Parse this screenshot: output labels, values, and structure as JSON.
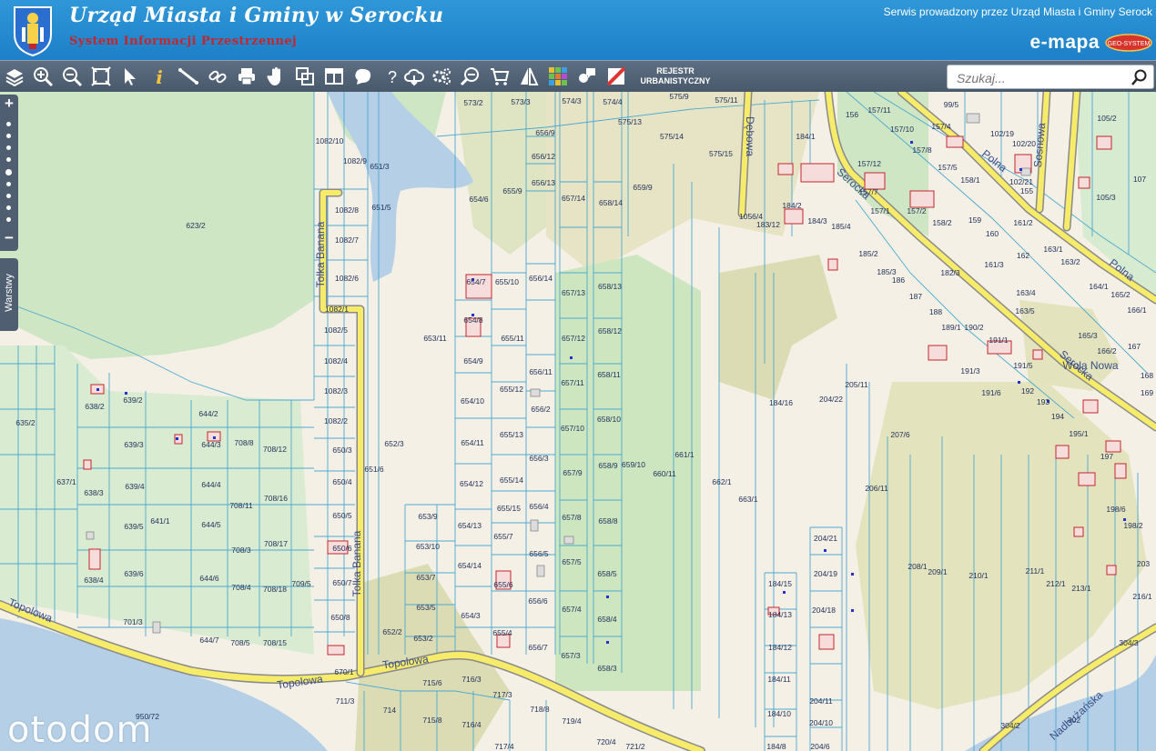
{
  "header": {
    "title": "Urząd Miasta i Gminy w Serocku",
    "subtitle": "System Informacji Przestrzennej",
    "service": "Serwis prowadzony przez Urząd Miasta i Gminy Serock",
    "brand": "e-mapa",
    "geo_logo": "GEO-SYSTEM"
  },
  "toolbar": {
    "tools": [
      "layers-icon",
      "zoom-in-icon",
      "zoom-out-icon",
      "zoom-extent-icon",
      "select-arrow-icon",
      "info-icon",
      "measure-distance-icon",
      "measure-link-icon",
      "print-icon",
      "pan-hand-icon",
      "copy-icon",
      "layout-icon",
      "shape-icon",
      "help-icon",
      "cloud-download-icon",
      "settings-icon",
      "search-zoom-icon",
      "cart-icon",
      "symbol-icon",
      "grid-color-icon",
      "comment-icon",
      "cancel-slash-icon"
    ],
    "rejestr_line1": "REJESTR",
    "rejestr_line2": "URBANISTYCZNY",
    "search_placeholder": "Szukaj..."
  },
  "side": {
    "zoom_in": "+",
    "zoom_out": "−",
    "layers_tab": "Warstwy"
  },
  "map": {
    "streets": [
      "Topolowa",
      "Topolowa",
      "Topolowa",
      "Tolka Banana",
      "Tolka Banana",
      "Dębowa",
      "Serocka",
      "Serocka",
      "Polna",
      "Polna",
      "Sosnowa",
      "Nadbużańska",
      "Wola Nowa"
    ],
    "parcels": [
      "573/2",
      "573/3",
      "574/3",
      "574/4",
      "575/9",
      "575/11",
      "575/13",
      "575/14",
      "575/15",
      "1082/10",
      "1082/9",
      "1082/8",
      "1082/7",
      "1082/6",
      "1082/1",
      "1082/5",
      "1082/4",
      "1082/3",
      "1082/2",
      "651/3",
      "651/5",
      "651/6",
      "652/3",
      "652/2",
      "623/2",
      "635/2",
      "637/1",
      "638/2",
      "638/3",
      "638/4",
      "639/2",
      "639/3",
      "639/4",
      "639/5",
      "639/6",
      "641/1",
      "644/2",
      "644/3",
      "644/4",
      "644/5",
      "644/6",
      "644/7",
      "650/3",
      "650/4",
      "650/5",
      "650/6",
      "650/7",
      "650/8",
      "653/11",
      "653/9",
      "653/10",
      "653/7",
      "653/5",
      "653/2",
      "654/6",
      "654/7",
      "654/8",
      "654/9",
      "654/10",
      "654/11",
      "654/12",
      "654/13",
      "654/14",
      "654/3",
      "655/9",
      "655/10",
      "655/11",
      "655/12",
      "655/13",
      "655/14",
      "655/15",
      "655/7",
      "655/6",
      "655/4",
      "656/9",
      "656/12",
      "656/13",
      "656/14",
      "656/11",
      "656/2",
      "656/3",
      "656/4",
      "656/5",
      "656/6",
      "656/7",
      "657/14",
      "657/13",
      "657/12",
      "657/11",
      "657/10",
      "657/9",
      "657/8",
      "657/5",
      "657/4",
      "657/3",
      "658/14",
      "658/13",
      "658/12",
      "658/11",
      "658/10",
      "658/9",
      "658/8",
      "658/5",
      "658/4",
      "658/3",
      "659/9",
      "659/10",
      "660/11",
      "661/1",
      "662/1",
      "663/1",
      "670/1",
      "701/3",
      "708/4",
      "708/5",
      "708/8",
      "708/11",
      "708/12",
      "708/15",
      "708/16",
      "708/17",
      "708/18",
      "708/3",
      "709/5",
      "711/3",
      "714",
      "715/6",
      "715/8",
      "716/3",
      "716/4",
      "717/3",
      "717/4",
      "718/8",
      "719/4",
      "720/4",
      "721/2",
      "950/72",
      "1056/4",
      "183/12",
      "184/1",
      "184/2",
      "184/3",
      "184/16",
      "184/15",
      "184/13",
      "184/12",
      "184/11",
      "184/10",
      "184/8",
      "185/2",
      "185/3",
      "185/4",
      "186",
      "187",
      "188",
      "189/1",
      "190/2",
      "191/1",
      "191/3",
      "191/5",
      "191/6",
      "192",
      "193",
      "194",
      "195/1",
      "197",
      "198/6",
      "198/2",
      "156",
      "157/11",
      "157/10",
      "157/12",
      "157/7",
      "157/1",
      "157/2",
      "157/4",
      "157/8",
      "157/5",
      "158/1",
      "158/2",
      "159",
      "160",
      "161/2",
      "161/3",
      "162",
      "163/1",
      "163/2",
      "163/5",
      "163/4",
      "164/1",
      "165/2",
      "165/3",
      "166/1",
      "166/2",
      "167",
      "168",
      "102/19",
      "102/20",
      "102/21",
      "105/2",
      "105/3",
      "99/5",
      "107",
      "155",
      "182/3",
      "204/21",
      "204/19",
      "204/18",
      "204/11",
      "204/10",
      "204/6",
      "204/22",
      "205/11",
      "206/11",
      "207/6",
      "208/1",
      "209/1",
      "210/1",
      "211/1",
      "212/1",
      "213/1",
      "216/1",
      "203",
      "302",
      "304/2",
      "304/3",
      "169"
    ]
  },
  "watermark": "otodom"
}
